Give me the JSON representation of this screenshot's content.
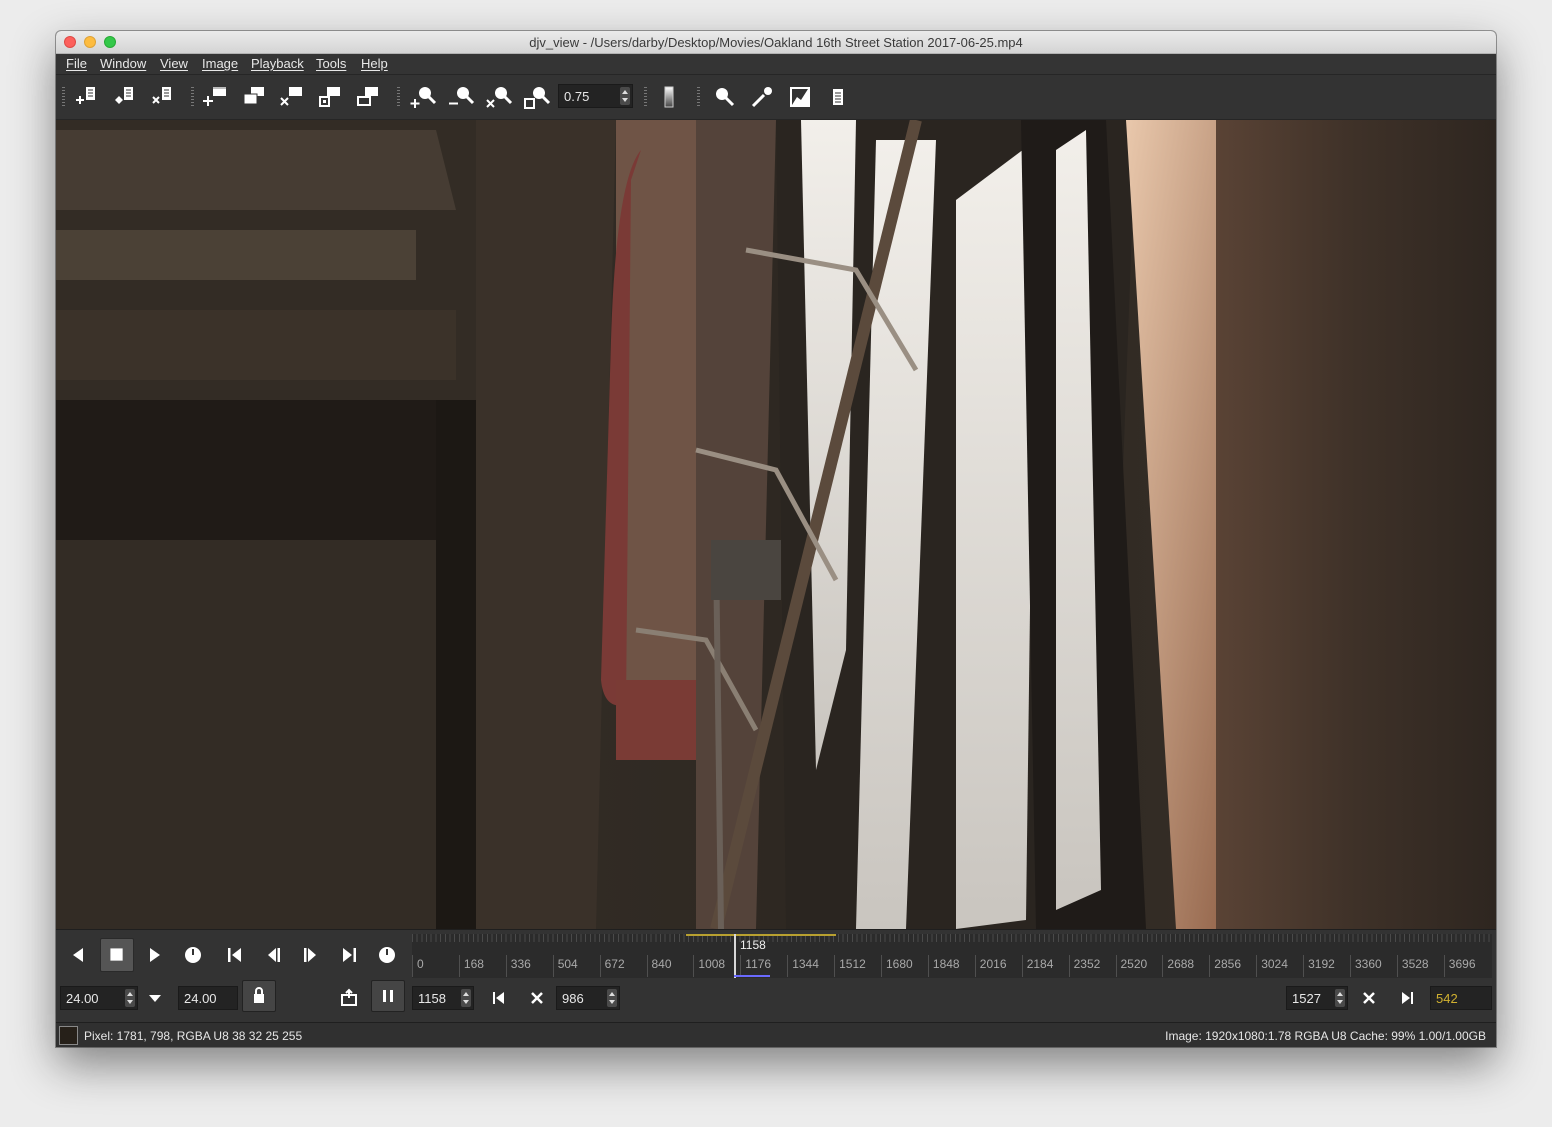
{
  "window": {
    "title": "djv_view - /Users/darby/Desktop/Movies/Oakland 16th Street Station 2017-06-25.mp4"
  },
  "menu": [
    "File",
    "Window",
    "View",
    "Image",
    "Playback",
    "Tools",
    "Help"
  ],
  "toolbar": {
    "file_buttons": [
      "file-open-icon",
      "file-reload-icon",
      "file-close-icon"
    ],
    "window_buttons": [
      "window-new-icon",
      "window-copy-icon",
      "window-close-icon",
      "window-fit-icon",
      "window-fullscreen-icon"
    ],
    "view_buttons": [
      "zoom-in-icon",
      "zoom-out-icon",
      "zoom-reset-icon",
      "fit-icon"
    ],
    "zoom_value": "0.75",
    "tool_buttons": [
      "display-profile-icon",
      "magnify-icon",
      "color-picker-icon",
      "histogram-icon",
      "info-icon"
    ]
  },
  "playback": {
    "buttons": [
      "reverse-icon",
      "stop-icon",
      "forward-icon",
      "loop-icon",
      "start-icon",
      "prev-frame-icon",
      "next-frame-icon",
      "end-icon",
      "loop-icon"
    ],
    "speed": "24.00",
    "real_speed": "24.00",
    "current_frame": "1158",
    "in_point": "986",
    "out_point": "1527",
    "duration": "542",
    "timeline": {
      "cursor_frame": "1158",
      "labels": [
        "0",
        "168",
        "336",
        "504",
        "672",
        "840",
        "1008",
        "1176",
        "1344",
        "1512",
        "1680",
        "1848",
        "2016",
        "2184",
        "2352",
        "2520",
        "2688",
        "2856",
        "3024",
        "3192",
        "3360",
        "3528",
        "3696"
      ]
    }
  },
  "status": {
    "pixel": "Pixel: 1781, 798, RGBA U8 38 32 25 255",
    "image": "Image: 1920x1080:1.78 RGBA U8  Cache: 99% 1.00/1.00GB"
  },
  "colors": {
    "accent_inout": "#b8a030",
    "cursor_underline": "#6a6aff",
    "duration_text": "#d0b030"
  }
}
